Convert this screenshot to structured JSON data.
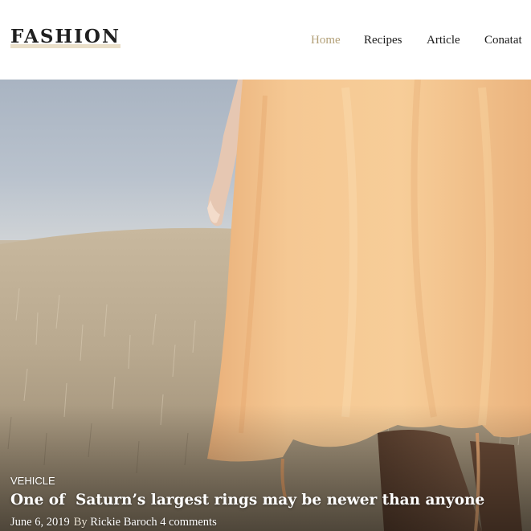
{
  "brand": {
    "logo_text": "FASHION"
  },
  "nav": {
    "items": [
      {
        "label": "Home",
        "active": true
      },
      {
        "label": "Recipes",
        "active": false
      },
      {
        "label": "Article",
        "active": false
      },
      {
        "label": "Conatat",
        "active": false
      }
    ]
  },
  "hero": {
    "image_description": "model-in-peach-dress-field",
    "category": "VEHICLE",
    "title": "One of  Saturn’s largest rings may be newer than anyone",
    "date": "June 6, 2019",
    "by_label": "By",
    "author": "Rickie Baroch",
    "comments": "4 comments"
  },
  "colors": {
    "accent": "#b3a078",
    "nav_text": "#1a1a1a",
    "logo_text": "#1f1f1f",
    "logo_underline": "#eadfc9",
    "dress": "#f2c48e",
    "sky": "#aab7c7"
  }
}
